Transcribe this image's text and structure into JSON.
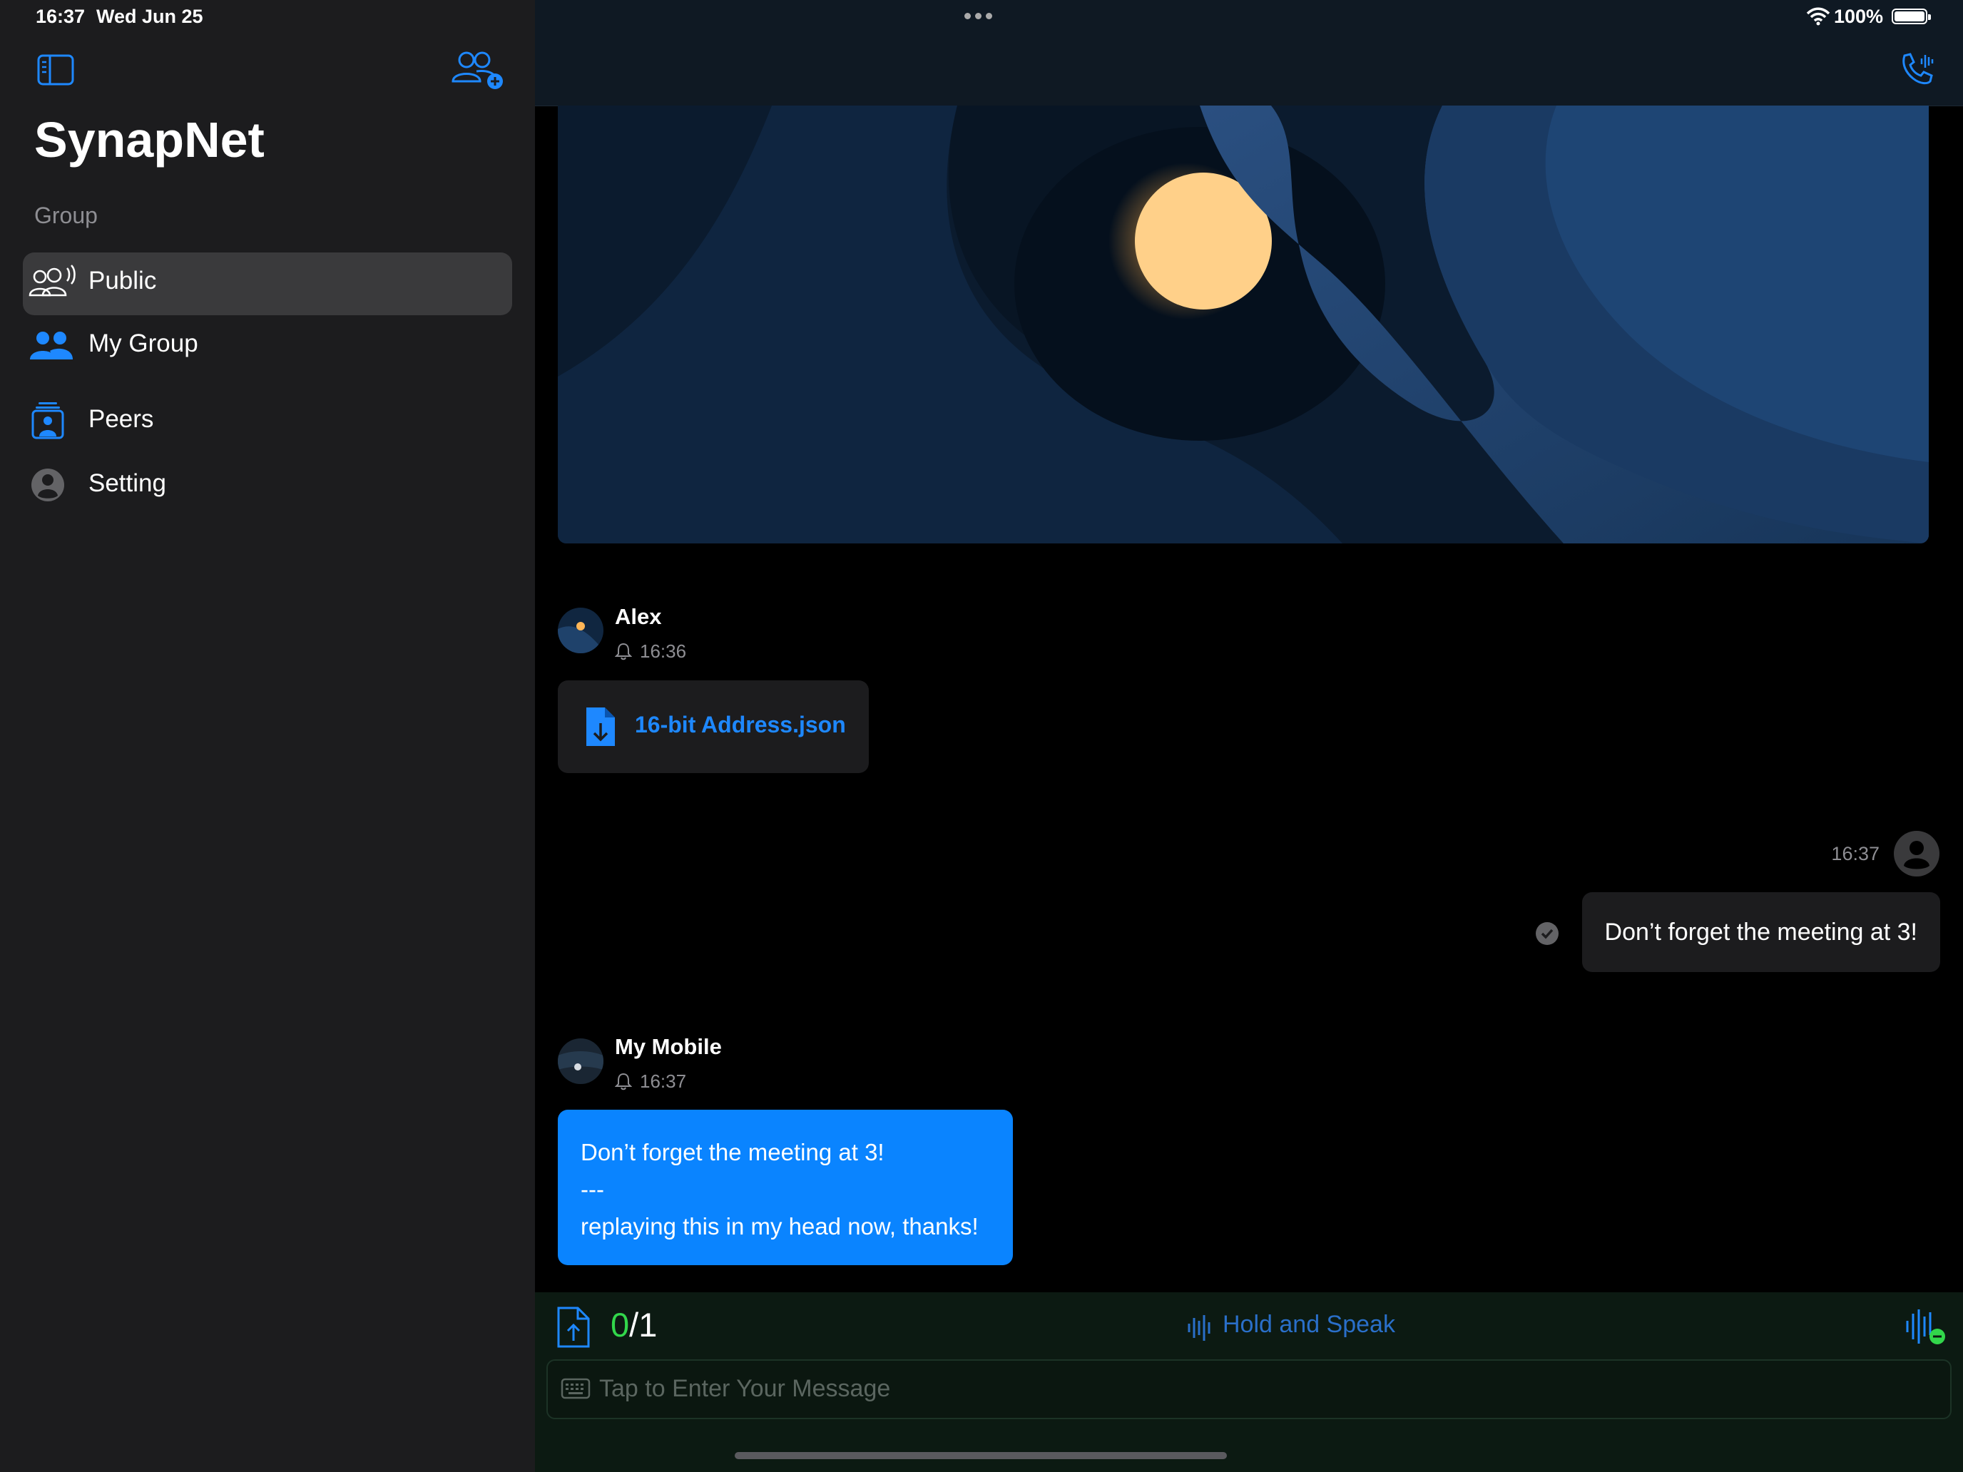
{
  "status_bar": {
    "time": "16:37",
    "date": "Wed Jun 25",
    "battery": "100%"
  },
  "sidebar": {
    "app_title": "SynapNet",
    "section_label": "Group",
    "items": [
      {
        "label": "Public",
        "icon": "group-broadcast-icon",
        "active": true
      },
      {
        "label": "My Group",
        "icon": "two-people-icon",
        "active": false
      },
      {
        "label": "Peers",
        "icon": "contact-card-icon",
        "active": false
      },
      {
        "label": "Setting",
        "icon": "person-circle-icon",
        "active": false
      }
    ]
  },
  "messages": [
    {
      "sender": "Alex",
      "time": "16:36",
      "type": "file",
      "file_name": "16-bit Address.json"
    },
    {
      "direction": "outgoing",
      "time": "16:37",
      "text": "Don’t forget the meeting at 3!"
    },
    {
      "sender": "My Mobile",
      "time": "16:37",
      "type": "text",
      "lines": [
        "Don’t forget the meeting at 3!",
        "---",
        "replaying this in my head now, thanks!"
      ]
    }
  ],
  "composer": {
    "count_current": "0",
    "count_separator": "/",
    "count_total": "1",
    "hold_speak": "Hold and Speak",
    "placeholder": "Tap to Enter Your Message"
  },
  "colors": {
    "accent": "#0a84ff",
    "sidebar_bg": "#1c1c1e",
    "counter_green": "#32d74b"
  }
}
